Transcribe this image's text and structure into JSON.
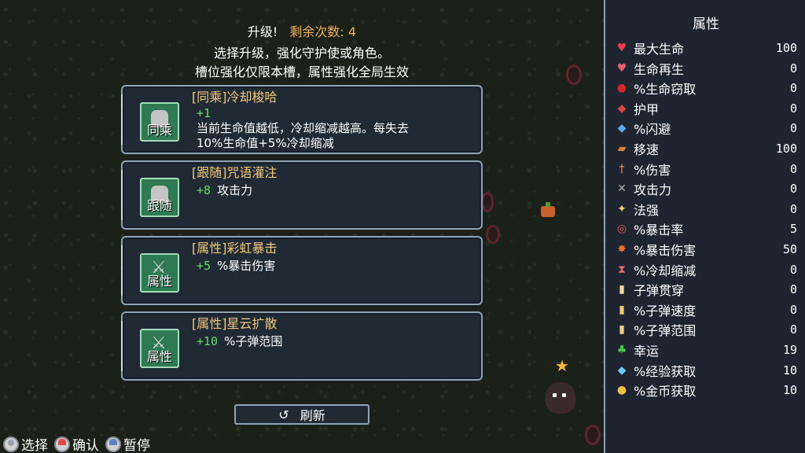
{
  "header": {
    "upgrade_label": "升级!",
    "remaining_label": "剩余次数: 4",
    "line2": "选择升级，强化守护使或角色。",
    "line3": "槽位强化仅限本槽，属性强化全局生效"
  },
  "cards": [
    {
      "title": "[同乘]冷却梭哈",
      "tag": "同乘",
      "value": "+1",
      "desc_line1": "当前生命值越低，冷却缩减越高。每失去",
      "desc_line2": "10%生命值+5%冷却缩减",
      "icon": "companion-icon"
    },
    {
      "title": "[跟随]咒语灌注",
      "tag": "跟随",
      "value": "+8",
      "desc": "攻击力",
      "icon": "companion-icon"
    },
    {
      "title": "[属性]彩虹暴击",
      "tag": "属性",
      "value": "+5",
      "desc": "%暴击伤害",
      "icon": "attribute-icon"
    },
    {
      "title": "[属性]星云扩散",
      "tag": "属性",
      "value": "+10",
      "desc": "%子弹范围",
      "icon": "attribute-icon"
    }
  ],
  "refresh": {
    "label": "刷新",
    "icon": "refresh-icon"
  },
  "hints": [
    {
      "label": "选择",
      "icon": "gamepad-button-icon"
    },
    {
      "label": "确认",
      "icon": "gamepad-button-icon"
    },
    {
      "label": "暂停",
      "icon": "gamepad-button-icon"
    }
  ],
  "stats_panel": {
    "title": "属性",
    "stats": [
      {
        "name": "最大生命",
        "value": "100",
        "icon": "heart-icon",
        "glyph": "♥",
        "color": "#e8404a"
      },
      {
        "name": "生命再生",
        "value": "0",
        "icon": "heart-plus-icon",
        "glyph": "♥",
        "color": "#e86070"
      },
      {
        "name": "%生命窃取",
        "value": "0",
        "icon": "blood-drop-icon",
        "glyph": "●",
        "color": "#d02a2a"
      },
      {
        "name": "护甲",
        "value": "0",
        "icon": "shield-icon",
        "glyph": "◆",
        "color": "#d84848"
      },
      {
        "name": "%闪避",
        "value": "0",
        "icon": "dodge-icon",
        "glyph": "◆",
        "color": "#5aa8f0"
      },
      {
        "name": "移速",
        "value": "100",
        "icon": "boot-icon",
        "glyph": "▰",
        "color": "#e0803a"
      },
      {
        "name": "%伤害",
        "value": "0",
        "icon": "sword-icon",
        "glyph": "†",
        "color": "#e09060"
      },
      {
        "name": "攻击力",
        "value": "0",
        "icon": "crossed-swords-icon",
        "glyph": "✕",
        "color": "#b0b0b0"
      },
      {
        "name": "法强",
        "value": "0",
        "icon": "sparkle-icon",
        "glyph": "✦",
        "color": "#f0d070"
      },
      {
        "name": "%暴击率",
        "value": "5",
        "icon": "target-icon",
        "glyph": "◎",
        "color": "#e05a5a"
      },
      {
        "name": "%暴击伤害",
        "value": "50",
        "icon": "burst-icon",
        "glyph": "✸",
        "color": "#f06a3a"
      },
      {
        "name": "%冷却缩减",
        "value": "0",
        "icon": "hourglass-icon",
        "glyph": "⧗",
        "color": "#e07070"
      },
      {
        "name": "子弹贯穿",
        "value": "0",
        "icon": "bullet-icon",
        "glyph": "▮",
        "color": "#f0d8a0"
      },
      {
        "name": "%子弹速度",
        "value": "0",
        "icon": "bullet-speed-icon",
        "glyph": "▮",
        "color": "#f0c870"
      },
      {
        "name": "%子弹范围",
        "value": "0",
        "icon": "bullet-range-icon",
        "glyph": "▮",
        "color": "#f0d090"
      },
      {
        "name": "幸运",
        "value": "19",
        "icon": "clover-icon",
        "glyph": "♣",
        "color": "#4ac84a"
      },
      {
        "name": "%经验获取",
        "value": "10",
        "icon": "crystal-icon",
        "glyph": "◆",
        "color": "#70c8f0"
      },
      {
        "name": "%金币获取",
        "value": "10",
        "icon": "money-bag-icon",
        "glyph": "●",
        "color": "#f0c040"
      }
    ]
  },
  "colors": {
    "card_bg": "#1f2a35",
    "card_border": "#8fa3b4",
    "title_gold": "#f3c87a",
    "value_green": "#6fdc6a",
    "remaining_orange": "#f0b25a"
  }
}
